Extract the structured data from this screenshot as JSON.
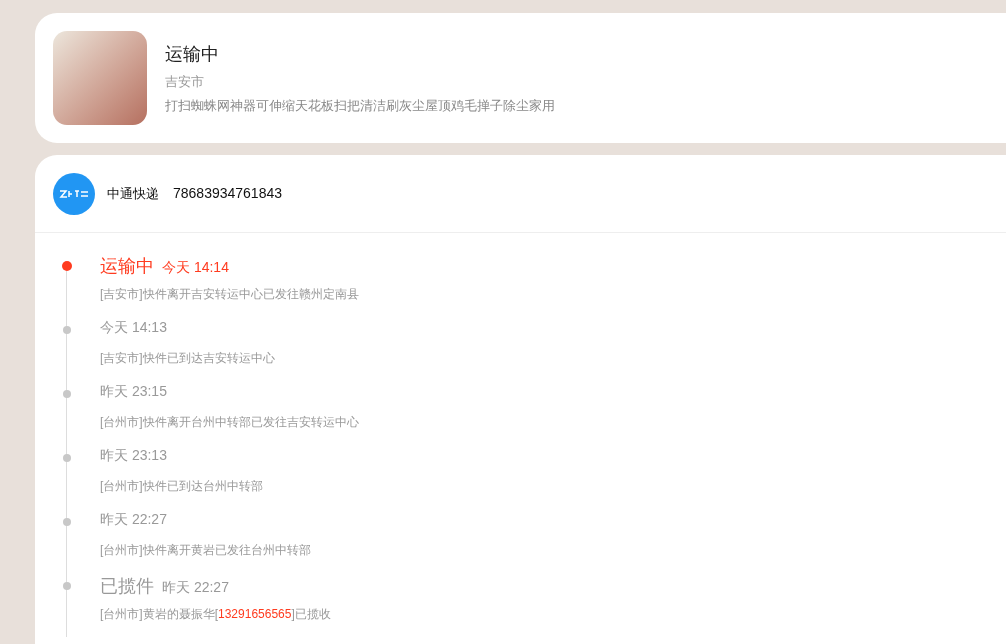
{
  "product": {
    "status": "运输中",
    "city": "吉安市",
    "title": "打扫蜘蛛网神器可伸缩天花板扫把清洁刷灰尘屋顶鸡毛掸子除尘家用"
  },
  "carrier": {
    "name": "中通快递",
    "tracking_number": "78683934761843"
  },
  "events": [
    {
      "status": "运输中",
      "time": "今天 14:14",
      "selected": true,
      "description": [
        {
          "kind": "text",
          "text": "[吉安市]快件离开吉安转运中心已发往赣州定南县"
        }
      ]
    },
    {
      "time": "今天 14:13",
      "selected": false,
      "description": [
        {
          "kind": "text",
          "text": "[吉安市]快件已到达吉安转运中心"
        }
      ]
    },
    {
      "time": "昨天 23:15",
      "selected": false,
      "description": [
        {
          "kind": "text",
          "text": "[台州市]快件离开台州中转部已发往吉安转运中心"
        }
      ]
    },
    {
      "time": "昨天 23:13",
      "selected": false,
      "description": [
        {
          "kind": "text",
          "text": "[台州市]快件已到达台州中转部"
        }
      ]
    },
    {
      "time": "昨天 22:27",
      "selected": false,
      "description": [
        {
          "kind": "text",
          "text": "[台州市]快件离开黄岩已发往台州中转部"
        }
      ]
    },
    {
      "status": "已揽件",
      "time": "昨天 22:27",
      "selected": false,
      "description": [
        {
          "kind": "text",
          "text": "[台州市]黄岩的聂振华["
        },
        {
          "kind": "phone",
          "text": "13291656565"
        },
        {
          "kind": "text",
          "text": "]已揽收"
        }
      ]
    }
  ]
}
